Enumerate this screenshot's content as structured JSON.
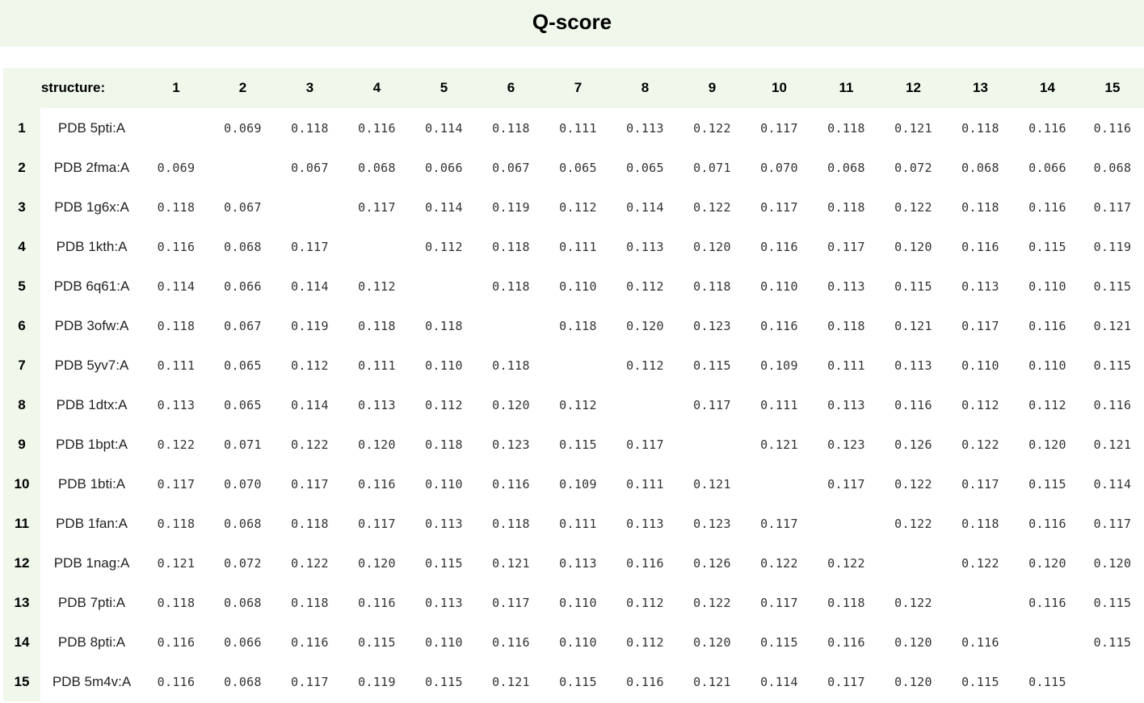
{
  "title": "Q-score",
  "header": {
    "structure_label": "structure:",
    "columns": [
      "1",
      "2",
      "3",
      "4",
      "5",
      "6",
      "7",
      "8",
      "9",
      "10",
      "11",
      "12",
      "13",
      "14",
      "15"
    ]
  },
  "rows": [
    {
      "index": "1",
      "label": "PDB 5pti:A",
      "values": [
        "",
        "0.069",
        "0.118",
        "0.116",
        "0.114",
        "0.118",
        "0.111",
        "0.113",
        "0.122",
        "0.117",
        "0.118",
        "0.121",
        "0.118",
        "0.116",
        "0.116"
      ]
    },
    {
      "index": "2",
      "label": "PDB 2fma:A",
      "values": [
        "0.069",
        "",
        "0.067",
        "0.068",
        "0.066",
        "0.067",
        "0.065",
        "0.065",
        "0.071",
        "0.070",
        "0.068",
        "0.072",
        "0.068",
        "0.066",
        "0.068"
      ]
    },
    {
      "index": "3",
      "label": "PDB 1g6x:A",
      "values": [
        "0.118",
        "0.067",
        "",
        "0.117",
        "0.114",
        "0.119",
        "0.112",
        "0.114",
        "0.122",
        "0.117",
        "0.118",
        "0.122",
        "0.118",
        "0.116",
        "0.117"
      ]
    },
    {
      "index": "4",
      "label": "PDB 1kth:A",
      "values": [
        "0.116",
        "0.068",
        "0.117",
        "",
        "0.112",
        "0.118",
        "0.111",
        "0.113",
        "0.120",
        "0.116",
        "0.117",
        "0.120",
        "0.116",
        "0.115",
        "0.119"
      ]
    },
    {
      "index": "5",
      "label": "PDB 6q61:A",
      "values": [
        "0.114",
        "0.066",
        "0.114",
        "0.112",
        "",
        "0.118",
        "0.110",
        "0.112",
        "0.118",
        "0.110",
        "0.113",
        "0.115",
        "0.113",
        "0.110",
        "0.115"
      ]
    },
    {
      "index": "6",
      "label": "PDB 3ofw:A",
      "values": [
        "0.118",
        "0.067",
        "0.119",
        "0.118",
        "0.118",
        "",
        "0.118",
        "0.120",
        "0.123",
        "0.116",
        "0.118",
        "0.121",
        "0.117",
        "0.116",
        "0.121"
      ]
    },
    {
      "index": "7",
      "label": "PDB 5yv7:A",
      "values": [
        "0.111",
        "0.065",
        "0.112",
        "0.111",
        "0.110",
        "0.118",
        "",
        "0.112",
        "0.115",
        "0.109",
        "0.111",
        "0.113",
        "0.110",
        "0.110",
        "0.115"
      ]
    },
    {
      "index": "8",
      "label": "PDB 1dtx:A",
      "values": [
        "0.113",
        "0.065",
        "0.114",
        "0.113",
        "0.112",
        "0.120",
        "0.112",
        "",
        "0.117",
        "0.111",
        "0.113",
        "0.116",
        "0.112",
        "0.112",
        "0.116"
      ]
    },
    {
      "index": "9",
      "label": "PDB 1bpt:A",
      "values": [
        "0.122",
        "0.071",
        "0.122",
        "0.120",
        "0.118",
        "0.123",
        "0.115",
        "0.117",
        "",
        "0.121",
        "0.123",
        "0.126",
        "0.122",
        "0.120",
        "0.121"
      ]
    },
    {
      "index": "10",
      "label": "PDB 1bti:A",
      "values": [
        "0.117",
        "0.070",
        "0.117",
        "0.116",
        "0.110",
        "0.116",
        "0.109",
        "0.111",
        "0.121",
        "",
        "0.117",
        "0.122",
        "0.117",
        "0.115",
        "0.114"
      ]
    },
    {
      "index": "11",
      "label": "PDB 1fan:A",
      "values": [
        "0.118",
        "0.068",
        "0.118",
        "0.117",
        "0.113",
        "0.118",
        "0.111",
        "0.113",
        "0.123",
        "0.117",
        "",
        "0.122",
        "0.118",
        "0.116",
        "0.117"
      ]
    },
    {
      "index": "12",
      "label": "PDB 1nag:A",
      "values": [
        "0.121",
        "0.072",
        "0.122",
        "0.120",
        "0.115",
        "0.121",
        "0.113",
        "0.116",
        "0.126",
        "0.122",
        "0.122",
        "",
        "0.122",
        "0.120",
        "0.120"
      ]
    },
    {
      "index": "13",
      "label": "PDB 7pti:A",
      "values": [
        "0.118",
        "0.068",
        "0.118",
        "0.116",
        "0.113",
        "0.117",
        "0.110",
        "0.112",
        "0.122",
        "0.117",
        "0.118",
        "0.122",
        "",
        "0.116",
        "0.115"
      ]
    },
    {
      "index": "14",
      "label": "PDB 8pti:A",
      "values": [
        "0.116",
        "0.066",
        "0.116",
        "0.115",
        "0.110",
        "0.116",
        "0.110",
        "0.112",
        "0.120",
        "0.115",
        "0.116",
        "0.120",
        "0.116",
        "",
        "0.115"
      ]
    },
    {
      "index": "15",
      "label": "PDB 5m4v:A",
      "values": [
        "0.116",
        "0.068",
        "0.117",
        "0.119",
        "0.115",
        "0.121",
        "0.115",
        "0.116",
        "0.121",
        "0.114",
        "0.117",
        "0.120",
        "0.115",
        "0.115",
        ""
      ]
    }
  ],
  "colors": {
    "header_background": "#f0f8ec",
    "text": "#000000",
    "cell_text": "#333333"
  }
}
